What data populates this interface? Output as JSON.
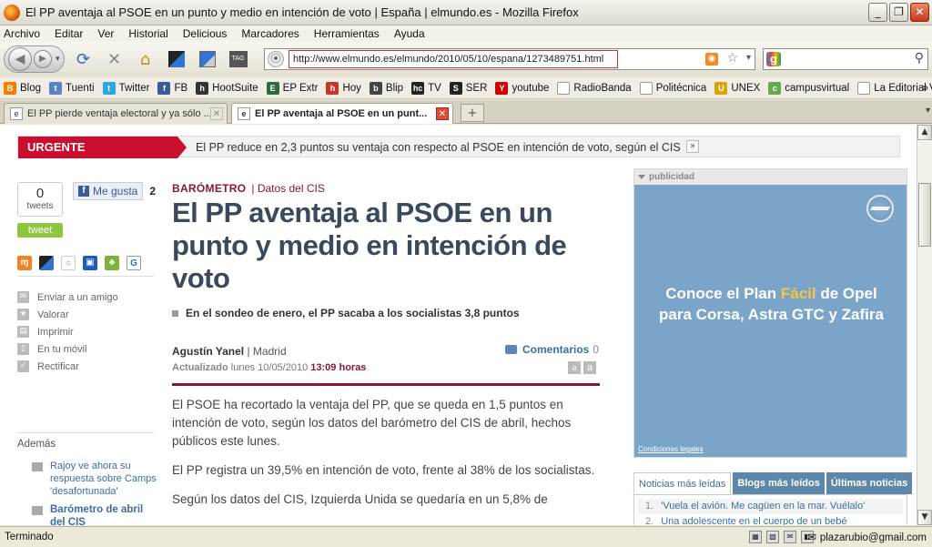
{
  "window": {
    "title": "El PP aventaja al PSOE en un punto y medio en intención de voto | España | elmundo.es - Mozilla Firefox",
    "minimize": "_",
    "maximize": "❐",
    "close": "✕"
  },
  "menu": [
    "Archivo",
    "Editar",
    "Ver",
    "Historial",
    "Delicious",
    "Marcadores",
    "Herramientas",
    "Ayuda"
  ],
  "toolbar": {
    "url": "http://www.elmundo.es/elmundo/2010/05/10/espana/1273489751.html",
    "tag_label": "TAG"
  },
  "bookmarks": [
    {
      "label": "Blog",
      "icon": "blogger-icon",
      "color": "#f57d00",
      "glyph": "B"
    },
    {
      "label": "Tuenti",
      "icon": "tuenti-icon",
      "color": "#5a82c4",
      "glyph": "t"
    },
    {
      "label": "Twitter",
      "icon": "twitter-icon",
      "color": "#2aa9e0",
      "glyph": "t"
    },
    {
      "label": "FB",
      "icon": "facebook-icon",
      "color": "#3b5998",
      "glyph": "f"
    },
    {
      "label": "HootSuite",
      "icon": "hootsuite-icon",
      "color": "#333333",
      "glyph": "h"
    },
    {
      "label": "EP Extr",
      "icon": "ep-icon",
      "color": "#2d6a3e",
      "glyph": "E"
    },
    {
      "label": "Hoy",
      "icon": "hoy-icon",
      "color": "#c0392b",
      "glyph": "h"
    },
    {
      "label": "Blip",
      "icon": "blip-icon",
      "color": "#444444",
      "glyph": "b"
    },
    {
      "label": "TV",
      "icon": "tv-icon",
      "color": "#222222",
      "glyph": "hc"
    },
    {
      "label": "SER",
      "icon": "ser-icon",
      "color": "#222222",
      "glyph": "S"
    },
    {
      "label": "youtube",
      "icon": "youtube-icon",
      "color": "#cc0000",
      "glyph": "Y"
    },
    {
      "label": "RadioBanda",
      "icon": "page-icon",
      "color": "#ffffff",
      "glyph": ""
    },
    {
      "label": "Politécnica",
      "icon": "page-icon",
      "color": "#ffffff",
      "glyph": ""
    },
    {
      "label": "UNEX",
      "icon": "unex-icon",
      "color": "#d9a404",
      "glyph": "U"
    },
    {
      "label": "campusvirtual",
      "icon": "campus-icon",
      "color": "#6aa84f",
      "glyph": "c"
    },
    {
      "label": "La Editorial Virtual",
      "icon": "page-icon",
      "color": "#ffffff",
      "glyph": ""
    }
  ],
  "bookmarks_more": "»",
  "tabs": [
    {
      "label": "El PP pierde ventaja electoral y ya sólo ...",
      "active": false
    },
    {
      "label": "El PP aventaja al PSOE en un punt...",
      "active": true
    }
  ],
  "new_tab": "+",
  "tab_list": "▾",
  "urgent": {
    "label": "URGENTE",
    "headline": "El PP reduce en 2,3 puntos su ventaja con respecto al PSOE en intención de voto, según el CIS",
    "more": "»"
  },
  "social": {
    "tweet_count": "0",
    "tweets_label": "tweets",
    "tweet_button": "tweet",
    "like_label": "Me gusta",
    "like_count": "2",
    "fb_glyph": "f"
  },
  "tools": [
    {
      "label": "Enviar a un amigo",
      "icon": "mail-icon"
    },
    {
      "label": "Valorar",
      "icon": "star-icon"
    },
    {
      "label": "Imprimir",
      "icon": "print-icon"
    },
    {
      "label": "En tu móvil",
      "icon": "mobile-icon"
    },
    {
      "label": "Rectificar",
      "icon": "check-icon"
    }
  ],
  "ademas": {
    "title": "Además",
    "items": [
      {
        "text": "Rajoy ve ahora su respuesta sobre Camps 'desafortunada'",
        "bold": false
      },
      {
        "text": "Barómetro de abril del CIS",
        "bold": true
      }
    ]
  },
  "article": {
    "category": "BARÓMETRO",
    "subcategory": "| Datos del CIS",
    "headline": "El PP aventaja al PSOE en un punto y medio en intención de voto",
    "deck": "En el sondeo de enero, el PP sacaba a los socialistas 3,8 puntos",
    "author": "Agustín Yanel",
    "city": "| Madrid",
    "updated_label": "Actualizado",
    "updated_date": "lunes 10/05/2010",
    "updated_time": "13:09 horas",
    "comments_label": "Comentarios",
    "comments_count": "0",
    "font_small": "a",
    "font_large": "a",
    "paragraphs": [
      "El PSOE ha recortado la ventaja del PP, que se queda en 1,5 puntos en intención de voto, según los datos del barómetro del CIS de abril, hechos públicos este lunes.",
      "El PP registra un 39,5% en intención de voto, frente al 38% de los socialistas.",
      "Según los datos del CIS, Izquierda Unida se quedaría en un 5,8% de"
    ]
  },
  "ad": {
    "header": "publicidad",
    "line1a": "Conoce el Plan ",
    "line1b": "Fácil",
    "line1c": " de Opel",
    "line2": "para Corsa, Astra GTC y Zafira",
    "legal": "Condiciones legales"
  },
  "right_tabs": [
    "Noticias más leídas",
    "Blogs más leídos",
    "Últimas noticias"
  ],
  "most_read": [
    {
      "n": "1.",
      "text": "'Vuela el avión. Me cagüen en la mar. Vuélalo'"
    },
    {
      "n": "2.",
      "text": "Una adolescente en el cuerpo de un bebé"
    }
  ],
  "status": {
    "text": "Terminado",
    "email": "plazarubio@gmail.com"
  },
  "colors": {
    "urgent_red": "#c8102e",
    "headline": "#3a4a5c",
    "accent": "#8a1538",
    "link": "#3a6ea5"
  }
}
